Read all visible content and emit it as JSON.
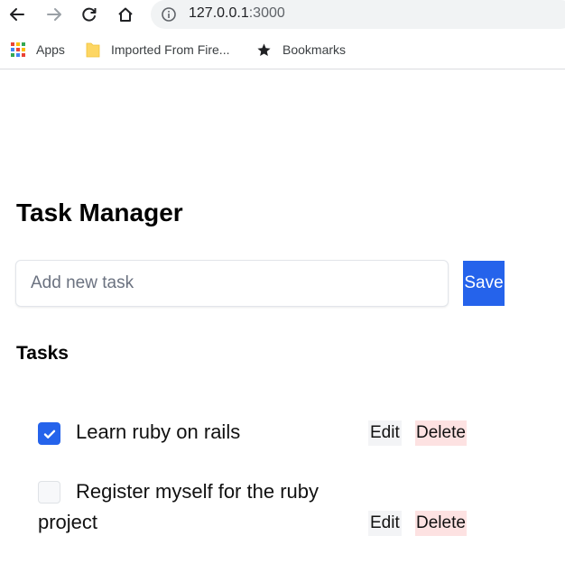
{
  "browser": {
    "url_host": "127.0.0.1",
    "url_port": ":3000",
    "bookmarks": [
      {
        "label": "Apps",
        "icon": "apps-grid-icon"
      },
      {
        "label": "Imported From Fire...",
        "icon": "folder-icon"
      },
      {
        "label": "Bookmarks",
        "icon": "star-icon"
      }
    ]
  },
  "app": {
    "title": "Task Manager",
    "input": {
      "placeholder": "Add new task",
      "value": ""
    },
    "save_label": "Save",
    "tasks_heading": "Tasks",
    "tasks": [
      {
        "text": "Learn ruby on rails",
        "completed": true,
        "edit_label": "Edit",
        "delete_label": "Delete"
      },
      {
        "text": "Register myself for the ruby project",
        "completed": false,
        "edit_label": "Edit",
        "delete_label": "Delete"
      }
    ]
  },
  "colors": {
    "primary": "#2563eb",
    "delete_bg": "#fde2e2",
    "edit_bg": "#f3f4f6"
  }
}
